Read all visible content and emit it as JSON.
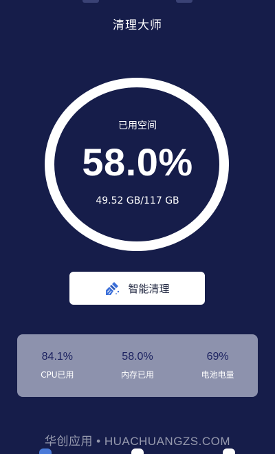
{
  "header": {
    "title": "清理大师"
  },
  "storage": {
    "label": "已用空间",
    "percent": "58.0%",
    "detail": "49.52 GB/117 GB",
    "used_fraction": 0.58
  },
  "actions": {
    "clean_label": "智能清理",
    "clean_icon": "broom-icon"
  },
  "stats": [
    {
      "value": "84.1%",
      "label": "CPU已用"
    },
    {
      "value": "58.0%",
      "label": "内存已用"
    },
    {
      "value": "69%",
      "label": "电池电量"
    }
  ],
  "watermark": "华创应用 • HUACHUANGZS.COM",
  "colors": {
    "background": "#161d4a",
    "panel": "#8d92ad",
    "stat_value": "#1c2260",
    "icon_blue": "#3b6fd9"
  }
}
